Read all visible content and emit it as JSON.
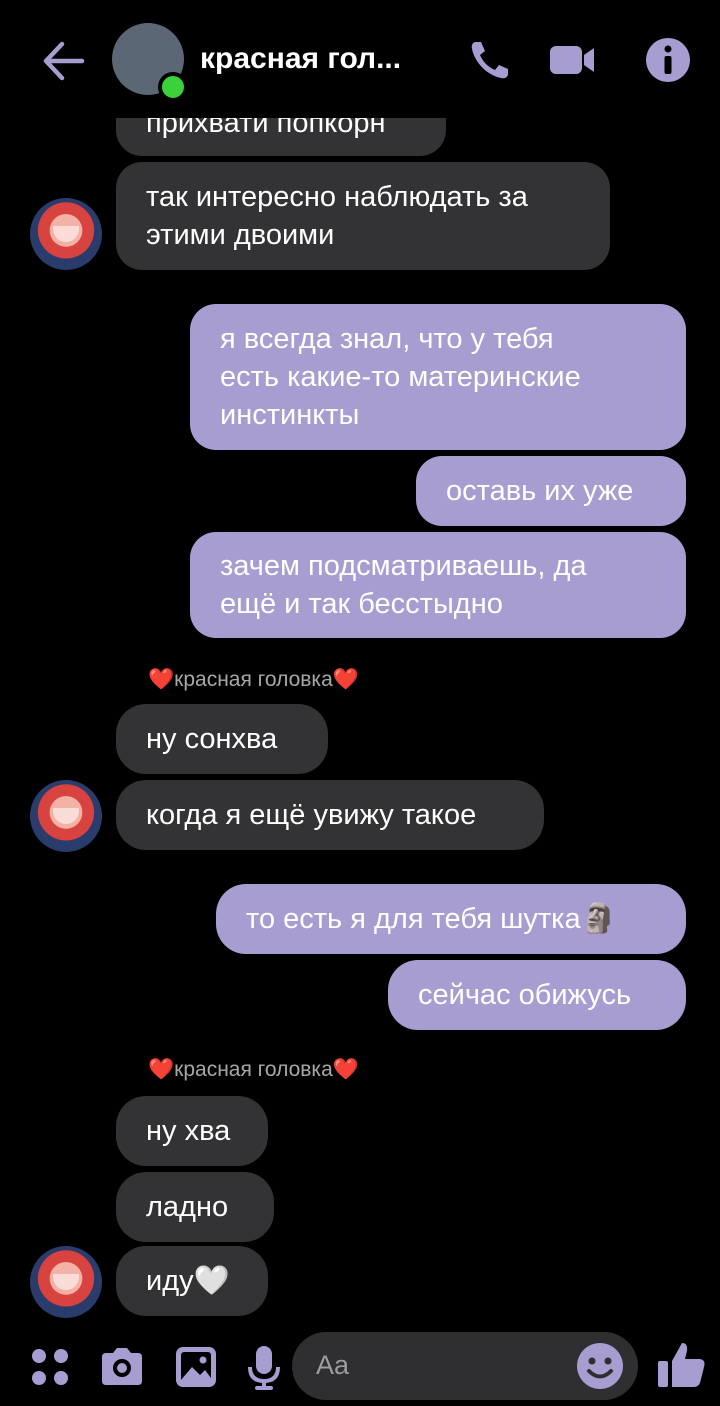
{
  "header": {
    "contact_name": "красная гол...",
    "icons": [
      "back-arrow-icon",
      "phone-icon",
      "video-call-icon",
      "info-icon"
    ]
  },
  "messages": {
    "m0": "прихвати попкорн",
    "m1_line1": "так интересно наблюдать за",
    "m1_line2": "этими двоими",
    "m2_line1": "я всегда знал, что у тебя",
    "m2_line2": "есть какие-то материнские",
    "m2_line3": "инстинкты",
    "m3": "оставь их уже",
    "m4_line1": "зачем подсматриваешь, да",
    "m4_line2": "ещё и так бесстыдно",
    "sender1": "❤️красная головка❤️",
    "m5": "ну сонхва",
    "m6": "когда я ещё увижу такое",
    "m7_text": "то есть я для тебя шутка",
    "m7_emoji": "🗿",
    "m8": "сейчас обижусь",
    "sender2": "❤️красная головка❤️",
    "m9": "ну хва",
    "m10": "ладно",
    "m11_text": "иду",
    "m11_emoji": "🤍"
  },
  "composer": {
    "placeholder": "Aa",
    "icons": [
      "apps-icon",
      "camera-icon",
      "gallery-icon",
      "microphone-icon",
      "emoji-icon",
      "thumbs-up-icon"
    ]
  },
  "colors": {
    "outgoing_bubble": "#a89dd0",
    "incoming_bubble": "#333235",
    "accent": "#a89dd0",
    "online": "#3bd13b"
  }
}
